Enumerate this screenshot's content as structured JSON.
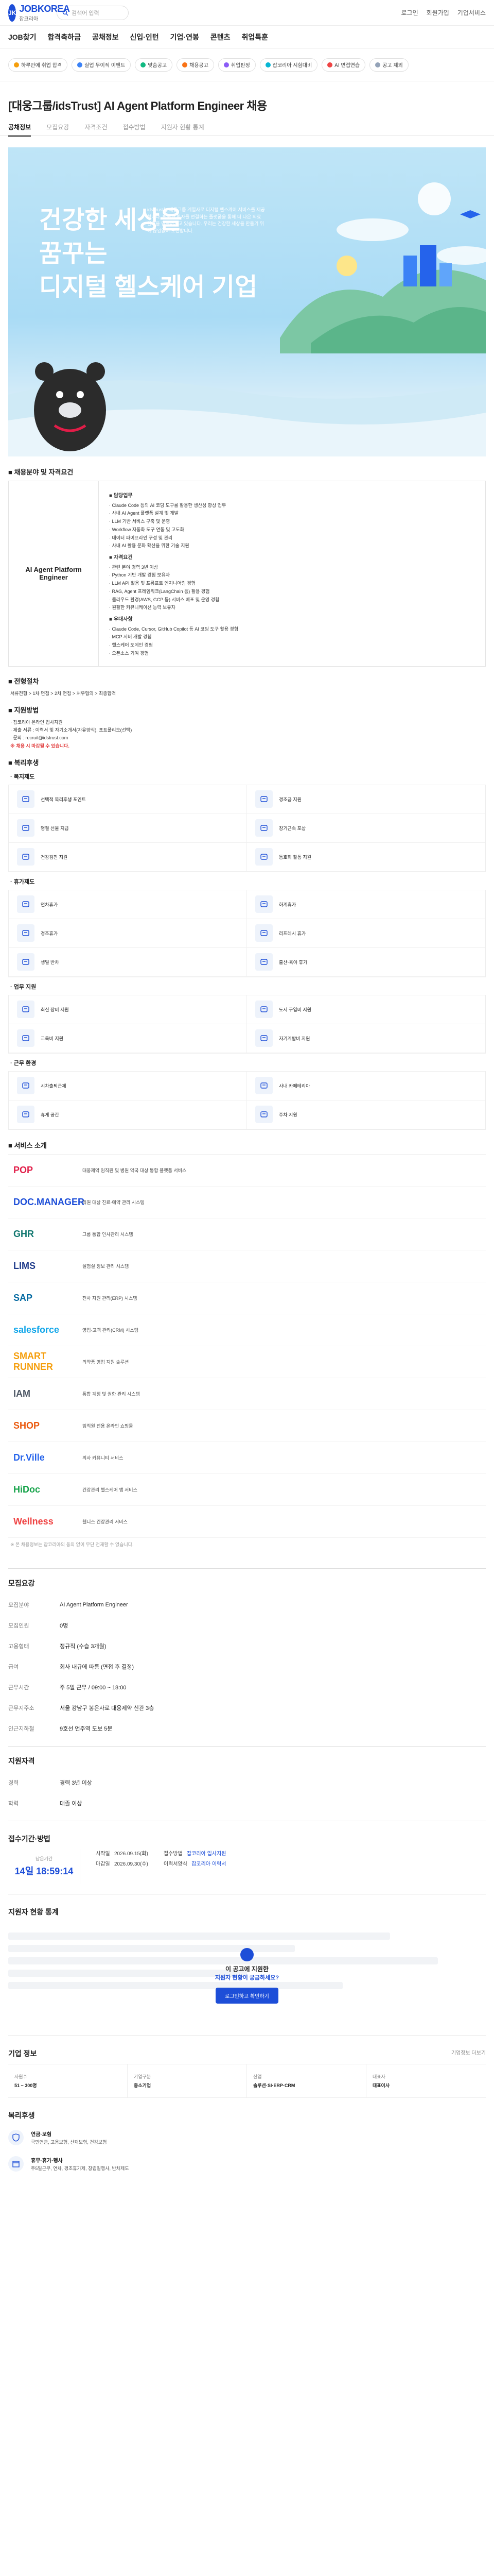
{
  "header": {
    "logo_text": "JOBKOREA",
    "logo_mark": "JK",
    "logo_caption": "잡코리아",
    "search_placeholder": "검색어 입력",
    "right_links": [
      "로그인",
      "회원가입",
      "기업서비스"
    ]
  },
  "gnb": [
    "JOB찾기",
    "합격축하금",
    "공채정보",
    "신입·인턴",
    "기업·연봉",
    "콘텐츠",
    "취업특훈"
  ],
  "chips": [
    {
      "label": "하루만에 취업 합격",
      "color": "#f59e0b"
    },
    {
      "label": "실업 무이직 이벤트",
      "color": "#3b82f6"
    },
    {
      "label": "맞춤공고",
      "color": "#10b981"
    },
    {
      "label": "채용공고",
      "color": "#f97316"
    },
    {
      "label": "취업판정",
      "color": "#8b5cf6"
    },
    {
      "label": "잡코리아 시험대비",
      "color": "#06b6d4"
    },
    {
      "label": "AI 면접연습",
      "color": "#ef4444"
    },
    {
      "label": "공고 제외",
      "color": "#94a3b8"
    }
  ],
  "job": {
    "title": "[대웅그룹/idsTrust] AI Agent Platform Engineer 채용",
    "tabs": [
      "공채정보",
      "모집요강",
      "자격조건",
      "접수방법",
      "지원자 현황 통계"
    ],
    "active_tab": "공채정보"
  },
  "hero": {
    "line1": "건강한 세상을",
    "line2": "꿈꾸는",
    "line3": "디지털 헬스케어 기업",
    "desc": "idsTrust는 대웅그룹 계열사로 디지털 헬스케어 서비스를 제공합니다. 병원과 환자를 연결하는 플랫폼을 통해 더 나은 의료 환경을 만들어가고 있습니다. 우리는 건강한 세상을 만들기 위해 끊임없이 도전합니다."
  },
  "sections": {
    "job_heading": "■ 채용분야 및 자격요건",
    "position_name": "AI Agent Platform Engineer",
    "duties_title": "담당업무",
    "duties": [
      "· Claude Code 등의 AI 코딩 도구를 활용한 생산성 향상 업무",
      "· 사내 AI Agent 플랫폼 설계 및 개발",
      "· LLM 기반 서비스 구축 및 운영",
      "· Workflow 자동화 도구 연동 및 고도화",
      "· 데이터 파이프라인 구성 및 관리",
      "· 사내 AI 활용 문화 확산을 위한 기술 지원"
    ],
    "req_title": "자격요건",
    "reqs": [
      "· 관련 분야 경력 3년 이상",
      "· Python 기반 개발 경험 보유자",
      "· LLM API 활용 및 프롬프트 엔지니어링 경험",
      "· RAG, Agent 프레임워크(LangChain 등) 활용 경험",
      "· 클라우드 환경(AWS, GCP 등) 서비스 배포 및 운영 경험",
      "· 원활한 커뮤니케이션 능력 보유자"
    ],
    "pref_title": "우대사항",
    "prefs": [
      "· Claude Code, Cursor, GitHub Copilot 등 AI 코딩 도구 활용 경험",
      "· MCP 서버 개발 경험",
      "· 헬스케어 도메인 경험",
      "· 오픈소스 기여 경험"
    ],
    "process_heading": "■ 전형절차",
    "process_text": "서류전형 > 1차 면접 > 2차 면접 > 처우협의 > 최종합격",
    "apply_heading": "■ 지원방법",
    "apply_lines": [
      "· 잡코리아 온라인 입사지원",
      "· 제출 서류 : 이력서 및 자기소개서(자유양식), 포트폴리오(선택)",
      "· 문의 : recruit@idstrust.com"
    ],
    "apply_warn": "※ 채용 시 마감될 수 있습니다.",
    "benefit_heading": "■ 복리후생",
    "benefit_groups": [
      {
        "title": "· 복지제도",
        "items": [
          "선택적 복리후생 포인트",
          "경조금 지원",
          "명절 선물 지급",
          "장기근속 포상",
          "건강검진 지원",
          "동호회 활동 지원"
        ]
      },
      {
        "title": "· 휴가제도",
        "items": [
          "연차휴가",
          "하계휴가",
          "경조휴가",
          "리프레시 휴가",
          "생일 반차",
          "출산·육아 휴가"
        ]
      },
      {
        "title": "· 업무 지원",
        "items": [
          "최신 장비 지원",
          "도서 구입비 지원",
          "교육비 지원",
          "자기계발비 지원"
        ]
      },
      {
        "title": "· 근무 환경",
        "items": [
          "시차출퇴근제",
          "사내 카페테리아",
          "휴게 공간",
          "주차 지원"
        ]
      }
    ],
    "clients_heading": "■ 서비스 소개",
    "clients": [
      {
        "name": "POP",
        "color": "#e11d48",
        "desc": "대웅제약 임직원 및 병원 약국 대상 통합 플랫폼 서비스"
      },
      {
        "name": "DOC.MANAGER",
        "color": "#1d4ed8",
        "desc": "의원 대상 진료·예약 관리 시스템"
      },
      {
        "name": "GHR",
        "color": "#0f766e",
        "desc": "그룹 통합 인사관리 시스템"
      },
      {
        "name": "LIMS",
        "color": "#1e3a8a",
        "desc": "실험실 정보 관리 시스템"
      },
      {
        "name": "SAP",
        "color": "#0369a1",
        "desc": "전사 자원 관리(ERP) 시스템"
      },
      {
        "name": "salesforce",
        "color": "#0ea5e9",
        "desc": "영업·고객 관리(CRM) 시스템"
      },
      {
        "name": "SMART RUNNER",
        "color": "#f59e0b",
        "desc": "의약품 영업 지원 솔루션"
      },
      {
        "name": "IAM",
        "color": "#4b5563",
        "desc": "통합 계정 및 권한 관리 시스템"
      },
      {
        "name": "SHOP",
        "color": "#ea580c",
        "desc": "임직원 전용 온라인 쇼핑몰"
      },
      {
        "name": "Dr.Ville",
        "color": "#2563eb",
        "desc": "의사 커뮤니티 서비스"
      },
      {
        "name": "HiDoc",
        "color": "#16a34a",
        "desc": "건강관리 헬스케어 앱 서비스"
      },
      {
        "name": "Wellness",
        "color": "#ef4444",
        "desc": "웰니스 건강관리 서비스"
      }
    ],
    "note": "※ 본 채용정보는 잡코리아의 동의 없이 무단 전재할 수 없습니다."
  },
  "summary": {
    "title": "모집요강",
    "rows": [
      {
        "k": "모집분야",
        "v": "AI Agent Platform Engineer"
      },
      {
        "k": "모집인원",
        "v": "0명"
      },
      {
        "k": "고용형태",
        "v": "정규직 (수습 3개월)"
      },
      {
        "k": "급여",
        "v": "회사 내규에 따름 (면접 후 결정)"
      },
      {
        "k": "근무시간",
        "v": "주 5일 근무 / 09:00 ~ 18:00"
      },
      {
        "k": "근무지주소",
        "v": "서울 강남구 봉은사로 대웅제약 신관 3층"
      },
      {
        "k": "인근지하철",
        "v": "9호선 언주역 도보 5분"
      }
    ]
  },
  "qualify": {
    "title": "지원자격",
    "rows": [
      {
        "k": "경력",
        "v": "경력 3년 이상"
      },
      {
        "k": "학력",
        "v": "대졸 이상"
      }
    ]
  },
  "deadline": {
    "title": "접수기간·방법",
    "remain_label": "남은기간",
    "remain_value": "14일 18:59:14",
    "start_label": "시작일",
    "start_value": "2026.09.15(화)",
    "end_label": "마감일",
    "end_value": "2026.09.30(수)",
    "method_label": "접수방법",
    "method_value": "잡코리아 입사지원",
    "form_label": "이력서양식",
    "form_value": "잡코리아 이력서"
  },
  "stats": {
    "title": "지원자 현황 통계",
    "overlay_t1": "이 공고에 지원한",
    "overlay_t2": "지원자 현황이 궁금하세요?",
    "button": "로그인하고 확인하기"
  },
  "company": {
    "title": "기업 정보",
    "more": "기업정보 더보기",
    "cells": [
      {
        "l": "사원수",
        "v": "51 ~ 300명"
      },
      {
        "l": "기업구분",
        "v": "중소기업"
      },
      {
        "l": "산업",
        "v": "솔루션·SI·ERP·CRM"
      },
      {
        "l": "대표자",
        "v": "대표이사"
      }
    ]
  },
  "welfare": {
    "title": "복리후생",
    "rows": [
      {
        "t": "연금·보험",
        "d": "국민연금, 고용보험, 산재보험, 건강보험"
      },
      {
        "t": "휴무·휴가·행사",
        "d": "주5일근무, 연차, 경조휴가제, 창립일행사, 반차제도"
      }
    ]
  }
}
